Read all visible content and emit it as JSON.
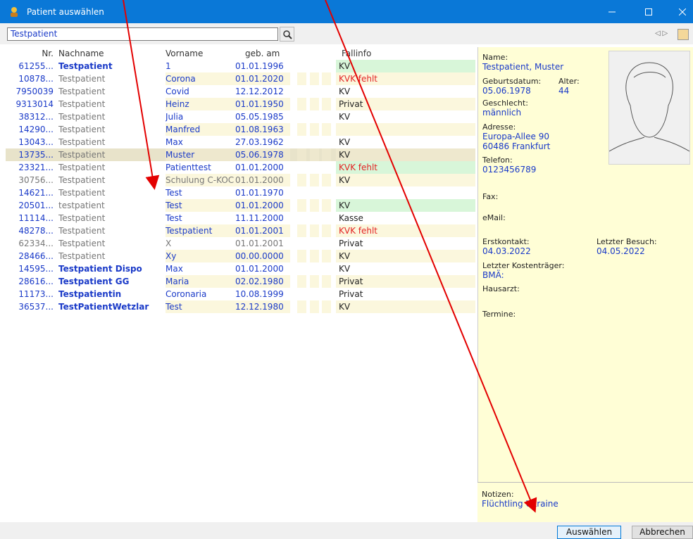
{
  "window": {
    "title": "Patient auswählen",
    "icon": "patient-icon",
    "controls": [
      "minimize-icon",
      "maximize-icon",
      "close-icon"
    ]
  },
  "search": {
    "value": "Testpatient"
  },
  "columns": {
    "nr": "Nr.",
    "nachname": "Nachname",
    "vorname": "Vorname",
    "geb": "geb. am",
    "fallinfo": "Fallinfo"
  },
  "rows": [
    {
      "nr": "61255...",
      "nachname": "Testpatient",
      "vorname": "1",
      "geb": "01.01.1996",
      "fallinfo": "KV",
      "style": "bold",
      "fall_color": "green",
      "fall_text_color": "normal"
    },
    {
      "nr": "10878...",
      "nachname": "Testpatient",
      "vorname": "Corona",
      "geb": "01.01.2020",
      "fallinfo": "KVK fehlt",
      "style": "gray",
      "fall_color": "",
      "fall_text_color": "red"
    },
    {
      "nr": "7950039",
      "nachname": "Testpatient",
      "vorname": "Covid",
      "geb": "12.12.2012",
      "fallinfo": "KV",
      "style": "gray",
      "fall_color": "",
      "fall_text_color": "normal"
    },
    {
      "nr": "9313014",
      "nachname": "Testpatient",
      "vorname": "Heinz",
      "geb": "01.01.1950",
      "fallinfo": "Privat",
      "style": "gray",
      "fall_color": "",
      "fall_text_color": "normal"
    },
    {
      "nr": "38312...",
      "nachname": "Testpatient",
      "vorname": "Julia",
      "geb": "05.05.1985",
      "fallinfo": "KV",
      "style": "gray",
      "fall_color": "",
      "fall_text_color": "normal"
    },
    {
      "nr": "14290...",
      "nachname": "Testpatient",
      "vorname": "Manfred",
      "geb": "01.08.1963",
      "fallinfo": "",
      "style": "gray",
      "fall_color": "",
      "fall_text_color": "normal"
    },
    {
      "nr": "13043...",
      "nachname": "Testpatient",
      "vorname": "Max",
      "geb": "27.03.1962",
      "fallinfo": "KV",
      "style": "gray",
      "fall_color": "",
      "fall_text_color": "normal"
    },
    {
      "nr": "13735...",
      "nachname": "Testpatient",
      "vorname": "Muster",
      "geb": "05.06.1978",
      "fallinfo": "KV",
      "style": "gray",
      "fall_color": "",
      "fall_text_color": "normal",
      "selected": true
    },
    {
      "nr": "23321...",
      "nachname": "Testpatient",
      "vorname": "Patienttest",
      "geb": "01.01.2000",
      "fallinfo": "KVK fehlt",
      "style": "gray",
      "fall_color": "green",
      "fall_text_color": "red"
    },
    {
      "nr": "30756...",
      "nachname": "Testpatient",
      "vorname": "Schulung C-KOC",
      "geb": "01.01.2000",
      "fallinfo": "KV",
      "style": "gray",
      "fall_color": "",
      "fall_text_color": "normal",
      "muted": true
    },
    {
      "nr": "14621...",
      "nachname": "Testpatient",
      "vorname": "Test",
      "geb": "01.01.1970",
      "fallinfo": "",
      "style": "gray",
      "fall_color": "",
      "fall_text_color": "normal"
    },
    {
      "nr": "20501...",
      "nachname": "testpatient",
      "vorname": "Test",
      "geb": "01.01.2000",
      "fallinfo": "KV",
      "style": "gray",
      "fall_color": "green",
      "fall_text_color": "normal"
    },
    {
      "nr": "11114...",
      "nachname": "Testpatient",
      "vorname": "Test",
      "geb": "11.11.2000",
      "fallinfo": "Kasse",
      "style": "gray",
      "fall_color": "",
      "fall_text_color": "normal"
    },
    {
      "nr": "48278...",
      "nachname": "Testpatient",
      "vorname": "Testpatient",
      "geb": "01.01.2001",
      "fallinfo": "KVK fehlt",
      "style": "gray",
      "fall_color": "",
      "fall_text_color": "red"
    },
    {
      "nr": "62334...",
      "nachname": "Testpatient",
      "vorname": "X",
      "geb": "01.01.2001",
      "fallinfo": "Privat",
      "style": "gray",
      "fall_color": "",
      "fall_text_color": "normal",
      "muted": true
    },
    {
      "nr": "28466...",
      "nachname": "Testpatient",
      "vorname": "Xy",
      "geb": "00.00.0000",
      "fallinfo": "KV",
      "style": "gray",
      "fall_color": "",
      "fall_text_color": "normal"
    },
    {
      "nr": "14595...",
      "nachname": "Testpatient Dispo",
      "vorname": "Max",
      "geb": "01.01.2000",
      "fallinfo": "KV",
      "style": "bold",
      "fall_color": "",
      "fall_text_color": "normal"
    },
    {
      "nr": "28616...",
      "nachname": "Testpatient GG",
      "vorname": "Maria",
      "geb": "02.02.1980",
      "fallinfo": "Privat",
      "style": "bold",
      "fall_color": "",
      "fall_text_color": "normal"
    },
    {
      "nr": "11173...",
      "nachname": "Testpatientin",
      "vorname": "Coronaria",
      "geb": "10.08.1999",
      "fallinfo": "Privat",
      "style": "bold",
      "fall_color": "",
      "fall_text_color": "normal"
    },
    {
      "nr": "36537...",
      "nachname": "TestPatientWetzlar",
      "vorname": "Test",
      "geb": "12.12.1980",
      "fallinfo": "KV",
      "style": "bold",
      "fall_color": "",
      "fall_text_color": "normal"
    }
  ],
  "details": {
    "name_label": "Name:",
    "name_value": "Testpatient, Muster",
    "dob_label": "Geburtsdatum:",
    "dob_value": "05.06.1978",
    "age_label": "Alter:",
    "age_value": "44",
    "gender_label": "Geschlecht:",
    "gender_value": "männlich",
    "address_label": "Adresse:",
    "address_line1": "Europa-Allee  90",
    "address_line2": "60486 Frankfurt",
    "phone_label": "Telefon:",
    "phone_value": "0123456789",
    "fax_label": "Fax:",
    "email_label": "eMail:",
    "first_contact_label": "Erstkontakt:",
    "first_contact_value": "04.03.2022",
    "last_visit_label": "Letzter Besuch:",
    "last_visit_value": "04.05.2022",
    "payer_label": "Letzter Kostenträger:",
    "payer_value": "BMÄ:",
    "gp_label": "Hausarzt:",
    "appointments_label": "Termine:",
    "notes_label": "Notizen:",
    "notes_value": "Flüchtling Ukraine"
  },
  "buttons": {
    "select": "Auswählen",
    "cancel": "Abbrechen"
  },
  "colors": {
    "titlebar": "#0a78d7",
    "accent_text": "#1a3ac8",
    "warning_text": "#e32424",
    "green_cell": "#d8f6d9",
    "detail_bg": "#fffed6",
    "annotation_arrow": "#e30000"
  }
}
